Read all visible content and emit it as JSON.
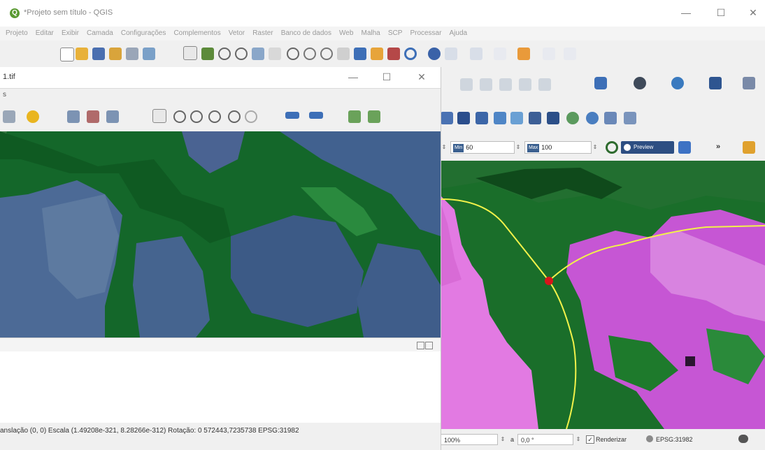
{
  "window": {
    "title": "*Projeto sem título - QGIS",
    "logo_letter": "Q",
    "controls": {
      "minimize": "—",
      "maximize": "☐",
      "close": "✕"
    }
  },
  "menu": [
    "Projeto",
    "Editar",
    "Exibir",
    "Camada",
    "Configurações",
    "Complementos",
    "Vetor",
    "Raster",
    "Banco de dados",
    "Web",
    "Malha",
    "SCP",
    "Processar",
    "Ajuda"
  ],
  "inner_window": {
    "title": "1.tif",
    "controls": {
      "minimize": "—",
      "maximize": "☐",
      "close": "✕"
    },
    "left_fragment": "s"
  },
  "scp_filter": {
    "min_label": "Min",
    "min_value": "60",
    "max_label": "Max",
    "max_value": "100",
    "preview_label": "Preview",
    "more_label": "»"
  },
  "left_status": {
    "text": "anslação (0, 0) Escala (1.49208e-321, 8.28266e-312) Rotação: 0   572443,7235738   EPSG:31982"
  },
  "right_status": {
    "scale": "100%",
    "rotation_prefix": "a",
    "rotation": "0,0 °",
    "render_label": "Renderizar",
    "crs": "EPSG:31982",
    "render_checked": "✓"
  },
  "colors": {
    "forest": "#1e7a2c",
    "water": "#3e5f8e",
    "pink": "#e27ae2",
    "magenta": "#c656d4",
    "line": "#f2f24a",
    "point": "#d8141b"
  }
}
